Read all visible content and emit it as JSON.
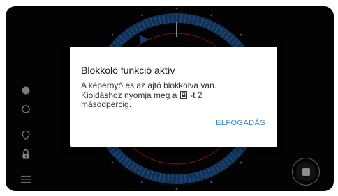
{
  "left_rail": {
    "items": [
      {
        "name": "filled-circle-icon"
      },
      {
        "name": "outline-circle-icon"
      },
      {
        "name": "lightbulb-icon"
      },
      {
        "name": "lock-icon"
      },
      {
        "name": "menu-icon"
      }
    ]
  },
  "dial": {
    "accent_color": "#1f5aa0",
    "tick_color": "#4a86c8",
    "needle_color": "#c01818"
  },
  "controls": {
    "stop_button_icon": "stop-icon"
  },
  "dialog": {
    "title": "Blokkoló funkció aktív",
    "line1": "A képernyő és az ajtó blokkolva van.",
    "line2_before": "Kioldáshoz nyomja meg a ",
    "line2_icon": "lock-icon",
    "line2_after": " -t 2",
    "line3": "másodpercig.",
    "action_label": "ELFOGADÁS",
    "action_color": "#3b86c6"
  }
}
